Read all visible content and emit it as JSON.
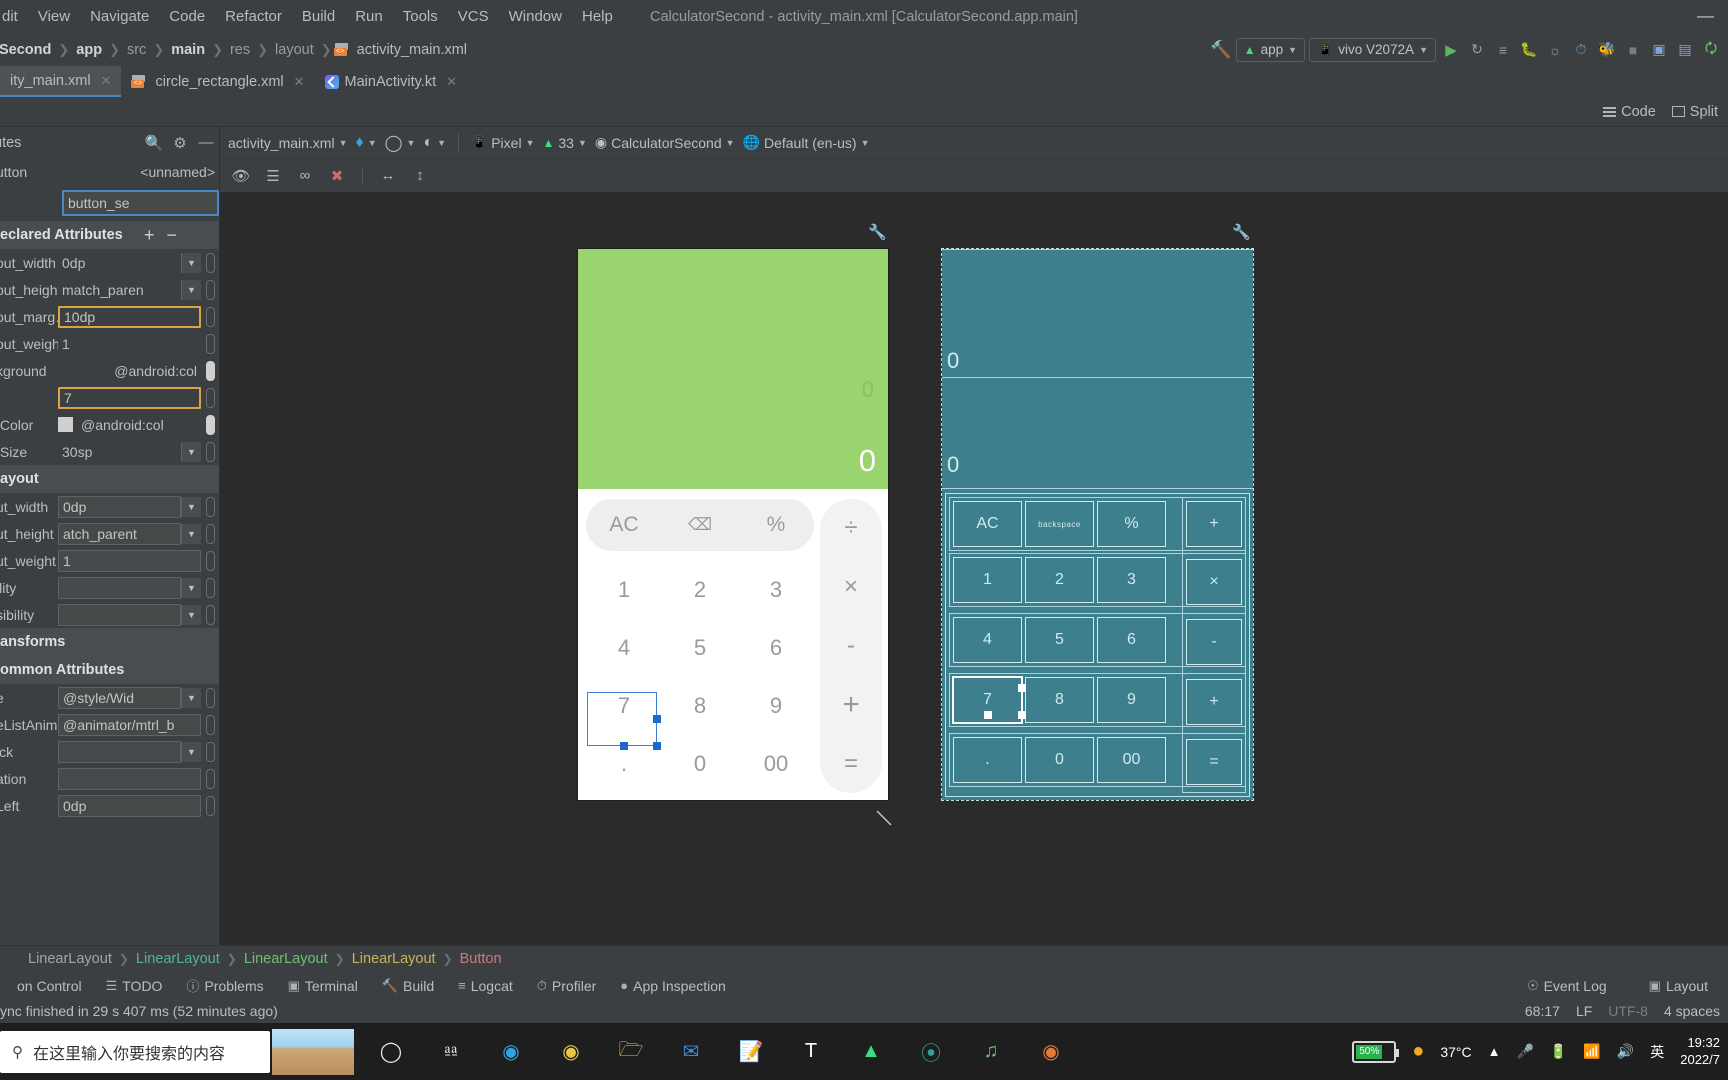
{
  "window": {
    "title": "CalculatorSecond - activity_main.xml [CalculatorSecond.app.main]",
    "minimize": "—"
  },
  "menu": {
    "items": [
      {
        "label": "dit",
        "mnemonic": ""
      },
      {
        "label": "View"
      },
      {
        "label": "Navigate"
      },
      {
        "label": "Code"
      },
      {
        "label": "Refactor"
      },
      {
        "label": "Build"
      },
      {
        "label": "Run"
      },
      {
        "label": "Tools"
      },
      {
        "label": "VCS"
      },
      {
        "label": "Window"
      },
      {
        "label": "Help"
      }
    ]
  },
  "breadcrumb": {
    "items": [
      "Second",
      "app",
      "src",
      "main",
      "res",
      "layout",
      "activity_main.xml"
    ]
  },
  "run_toolbar": {
    "module": "app",
    "device": "vivo V2072A",
    "icons": [
      "build-hammer-icon",
      "run-icon",
      "rerun-icon",
      "apply-changes-icon",
      "debug-icon",
      "attach-debugger-icon",
      "profiler-icon",
      "layout-inspector-icon",
      "stop-icon",
      "avd-manager-icon",
      "sdk-manager-icon",
      "sync-gradle-icon"
    ]
  },
  "tabs": [
    {
      "label": "ity_main.xml",
      "active": true,
      "icon": "xml-layout-icon"
    },
    {
      "label": "circle_rectangle.xml",
      "active": false,
      "icon": "xml-layout-icon"
    },
    {
      "label": "MainActivity.kt",
      "active": false,
      "icon": "kotlin-icon"
    }
  ],
  "editor_modes": {
    "code": "Code",
    "split": "Split"
  },
  "attributes_panel": {
    "title": "utes",
    "component_type": "utton",
    "component_id_placeholder": "<unnamed>",
    "id_value": "button_se",
    "declared_header": "eclared Attributes",
    "declared": [
      {
        "label": "out_width",
        "value": "0dp",
        "type": "combo"
      },
      {
        "label": "out_height",
        "value": "match_paren",
        "type": "combo"
      },
      {
        "label": "out_marg…",
        "value": "10dp",
        "type": "warn"
      },
      {
        "label": "out_weight",
        "value": "1",
        "type": "plain"
      },
      {
        "label": "kground",
        "value": "@android:col",
        "type": "resource",
        "pill": "filled"
      },
      {
        "label": "t",
        "value": "7",
        "type": "warn"
      },
      {
        "label": "tColor",
        "value": "@android:col",
        "type": "resource",
        "swatch": true,
        "pill": "filled"
      },
      {
        "label": "tSize",
        "value": "30sp",
        "type": "combo"
      }
    ],
    "layout_header": "ayout",
    "layout": [
      {
        "label": "ut_width",
        "value": "0dp",
        "type": "combo"
      },
      {
        "label": "ut_height",
        "value": "atch_parent",
        "type": "combo"
      },
      {
        "label": "ut_weight",
        "value": "1",
        "type": "field"
      },
      {
        "label": "ility",
        "value": "",
        "type": "combo"
      },
      {
        "label": "sibility",
        "value": "",
        "type": "combo"
      }
    ],
    "transforms_header": "ansforms",
    "common_header": "ommon Attributes",
    "common": [
      {
        "label": "e",
        "value": "@style/Wid",
        "type": "combo"
      },
      {
        "label": "eListAnim…",
        "value": "@animator/mtrl_b",
        "type": "field"
      },
      {
        "label": "ick",
        "value": "",
        "type": "combo"
      },
      {
        "label": "ation",
        "value": "",
        "type": "field"
      },
      {
        "label": "Left",
        "value": "0dp",
        "type": "field"
      }
    ]
  },
  "design_toolbar": {
    "file": "activity_main.xml",
    "device": "Pixel",
    "api": "33",
    "theme": "CalculatorSecond",
    "locale": "Default (en-us)",
    "icons": [
      "design-surface-icon",
      "orientation-icon",
      "night-mode-icon",
      "device-icon",
      "android-icon",
      "theme-icon",
      "globe-icon"
    ]
  },
  "design_toolbar2": {
    "icons": [
      "eye-icon",
      "constraints-icon",
      "autoconnect-off-icon",
      "clear-constraints-icon",
      "match-width-icon",
      "match-height-icon"
    ]
  },
  "preview": {
    "display_value_small": "0",
    "display_value_large": "0",
    "top_row": [
      "AC",
      "backspace-icon",
      "%"
    ],
    "keys": [
      "1",
      "2",
      "3",
      "4",
      "5",
      "6",
      "7",
      "8",
      "9",
      ".",
      "0",
      "00"
    ],
    "operators": [
      "÷",
      "×",
      "-",
      "+",
      "="
    ],
    "selected_key": "7",
    "backspace_label": "backspace"
  },
  "blueprint": {
    "display_value_small": "0",
    "display_value_large": "0",
    "top_row": [
      "AC",
      "backspace",
      "%"
    ],
    "keys": [
      "1",
      "2",
      "3",
      "4",
      "5",
      "6",
      "7",
      "8",
      "9",
      ".",
      "0",
      "00"
    ],
    "operators": [
      "+",
      "×",
      "-",
      "+",
      "="
    ]
  },
  "component_tree": [
    {
      "label": "LinearLayout",
      "color": "#9aa7b0"
    },
    {
      "label": "LinearLayout",
      "color": "#4fb3a5"
    },
    {
      "label": "LinearLayout",
      "color": "#6fbf73"
    },
    {
      "label": "LinearLayout",
      "color": "#c9b458"
    },
    {
      "label": "Button",
      "color": "#d0767f"
    }
  ],
  "tool_windows": [
    {
      "label": "on Control",
      "icon": "version-control-icon"
    },
    {
      "label": "TODO",
      "icon": "todo-icon"
    },
    {
      "label": "Problems",
      "icon": "problems-icon"
    },
    {
      "label": "Terminal",
      "icon": "terminal-icon"
    },
    {
      "label": "Build",
      "icon": "build-icon"
    },
    {
      "label": "Logcat",
      "icon": "logcat-icon"
    },
    {
      "label": "Profiler",
      "icon": "profiler-icon"
    },
    {
      "label": "App Inspection",
      "icon": "app-inspection-icon"
    }
  ],
  "tool_windows_right": [
    {
      "label": "Event Log",
      "icon": "event-log-icon"
    },
    {
      "label": "Layout",
      "icon": "layout-icon"
    }
  ],
  "status_bar": {
    "message": "ync finished in 29 s 407 ms (52 minutes ago)",
    "caret": "68:17",
    "line_sep": "LF",
    "encoding": "UTF-8",
    "indent": "4 spaces"
  },
  "taskbar": {
    "search_placeholder": "在这里输入你要搜索的内容",
    "apps": [
      "cortana-icon",
      "task-view-icon",
      "edge-icon",
      "chrome-icon",
      "file-explorer-icon",
      "mail-icon",
      "notes-icon",
      "typora-icon",
      "android-studio-icon",
      "wps-icon",
      "music-icon",
      "firefox-icon"
    ],
    "battery": "50%",
    "weather": "37°C",
    "ime": "英",
    "time": "19:32",
    "date": "2022/7"
  }
}
